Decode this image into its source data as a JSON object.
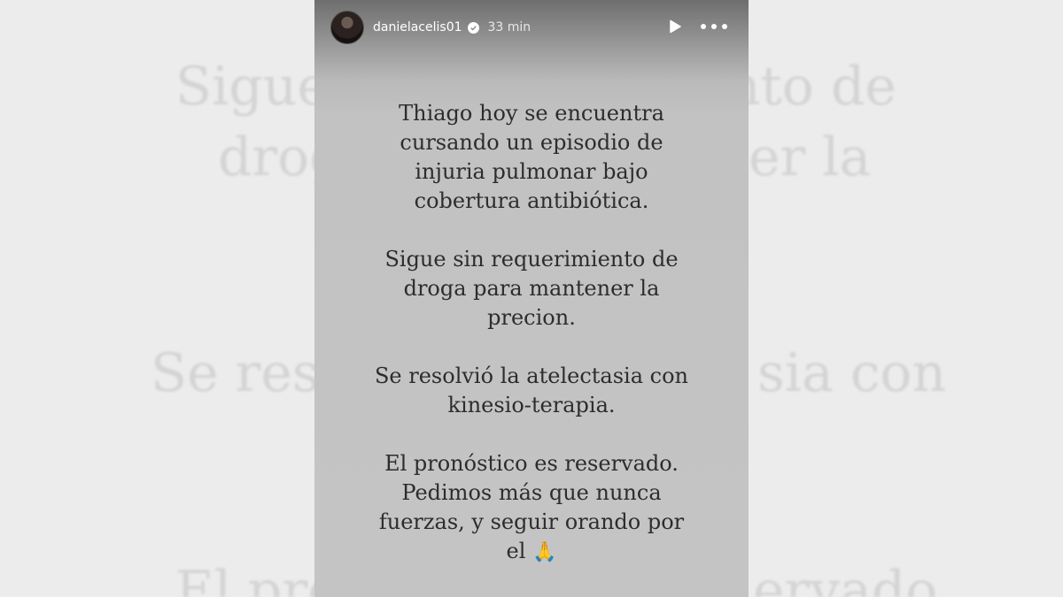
{
  "background_text": {
    "line1_left": "Sigue",
    "line1_right": "nto de",
    "line2_left": "drog",
    "line2_right": "er la",
    "line3_left": "Se reso",
    "line3_right": "sia con",
    "line4_left": "El pro",
    "line4_right": "ervado"
  },
  "story": {
    "username": "danielacelis01",
    "time": "33 min",
    "paragraphs": [
      [
        "Thiago hoy se encuentra",
        "cursando un episodio de",
        "injuria pulmonar bajo",
        "cobertura antibiótica."
      ],
      [
        "Sigue sin requerimiento de",
        "droga para mantener la",
        "precion."
      ],
      [
        "Se resolvió la atelectasia con",
        "kinesio-terapia."
      ],
      [
        "El pronóstico es reservado.",
        "Pedimos más que nunca",
        "fuerzas, y seguir orando por",
        "el"
      ]
    ],
    "emoji": "🙏"
  },
  "colors": {
    "page_bg": "#ececec",
    "story_bg": "#c4c4c4",
    "text": "#2d2d2d"
  },
  "icons": [
    "verified-icon",
    "play-icon",
    "more-options-icon"
  ]
}
